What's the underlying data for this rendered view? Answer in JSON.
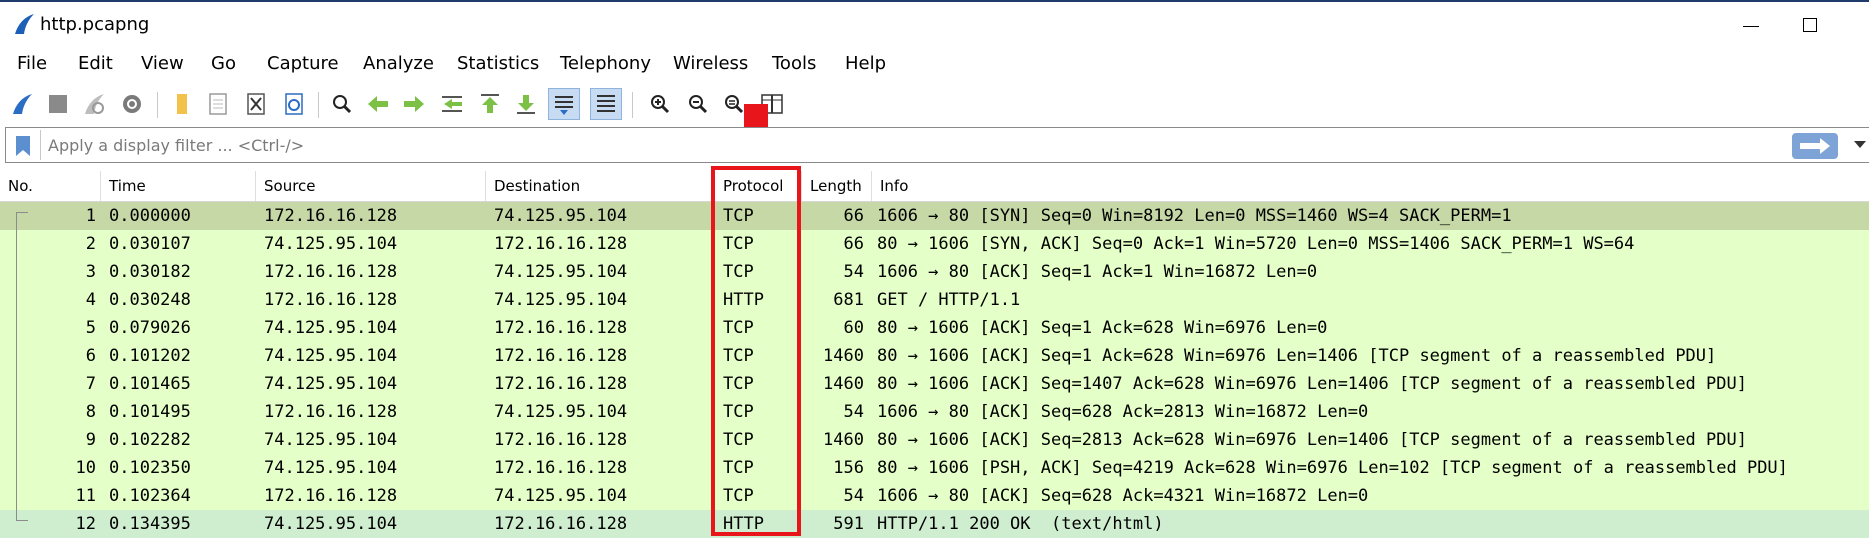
{
  "window": {
    "title": "http.pcapng"
  },
  "menu": [
    {
      "label": "File"
    },
    {
      "label": "Edit"
    },
    {
      "label": "View"
    },
    {
      "label": "Go"
    },
    {
      "label": "Capture"
    },
    {
      "label": "Analyze"
    },
    {
      "label": "Statistics"
    },
    {
      "label": "Telephony"
    },
    {
      "label": "Wireless"
    },
    {
      "label": "Tools"
    },
    {
      "label": "Help"
    }
  ],
  "toolbar": {
    "icons": [
      "start-capture-icon",
      "stop-capture-icon",
      "restart-capture-icon",
      "capture-options-icon",
      "open-file-icon",
      "save-file-icon",
      "close-file-icon",
      "reload-file-icon",
      "find-packet-icon",
      "go-back-icon",
      "go-forward-icon",
      "go-to-packet-icon",
      "first-packet-icon",
      "last-packet-icon",
      "autoscroll-icon",
      "colorize-icon",
      "zoom-in-icon",
      "zoom-out-icon",
      "normal-size-icon",
      "resize-columns-icon"
    ]
  },
  "filter": {
    "placeholder": "Apply a display filter ... <Ctrl-/>"
  },
  "columns": {
    "no": "No.",
    "time": "Time",
    "source": "Source",
    "destination": "Destination",
    "protocol": "Protocol",
    "length": "Length",
    "info": "Info"
  },
  "packets": [
    {
      "no": "1",
      "time": "0.000000",
      "source": "172.16.16.128",
      "destination": "74.125.95.104",
      "protocol": "TCP",
      "length": "66",
      "info": "1606 → 80 [SYN] Seq=0 Win=8192 Len=0 MSS=1460 WS=4 SACK_PERM=1"
    },
    {
      "no": "2",
      "time": "0.030107",
      "source": "74.125.95.104",
      "destination": "172.16.16.128",
      "protocol": "TCP",
      "length": "66",
      "info": "80 → 1606 [SYN, ACK] Seq=0 Ack=1 Win=5720 Len=0 MSS=1406 SACK_PERM=1 WS=64"
    },
    {
      "no": "3",
      "time": "0.030182",
      "source": "172.16.16.128",
      "destination": "74.125.95.104",
      "protocol": "TCP",
      "length": "54",
      "info": "1606 → 80 [ACK] Seq=1 Ack=1 Win=16872 Len=0"
    },
    {
      "no": "4",
      "time": "0.030248",
      "source": "172.16.16.128",
      "destination": "74.125.95.104",
      "protocol": "HTTP",
      "length": "681",
      "info": "GET / HTTP/1.1"
    },
    {
      "no": "5",
      "time": "0.079026",
      "source": "74.125.95.104",
      "destination": "172.16.16.128",
      "protocol": "TCP",
      "length": "60",
      "info": "80 → 1606 [ACK] Seq=1 Ack=628 Win=6976 Len=0"
    },
    {
      "no": "6",
      "time": "0.101202",
      "source": "74.125.95.104",
      "destination": "172.16.16.128",
      "protocol": "TCP",
      "length": "1460",
      "info": "80 → 1606 [ACK] Seq=1 Ack=628 Win=6976 Len=1406 [TCP segment of a reassembled PDU]"
    },
    {
      "no": "7",
      "time": "0.101465",
      "source": "74.125.95.104",
      "destination": "172.16.16.128",
      "protocol": "TCP",
      "length": "1460",
      "info": "80 → 1606 [ACK] Seq=1407 Ack=628 Win=6976 Len=1406 [TCP segment of a reassembled PDU]"
    },
    {
      "no": "8",
      "time": "0.101495",
      "source": "172.16.16.128",
      "destination": "74.125.95.104",
      "protocol": "TCP",
      "length": "54",
      "info": "1606 → 80 [ACK] Seq=628 Ack=2813 Win=16872 Len=0"
    },
    {
      "no": "9",
      "time": "0.102282",
      "source": "74.125.95.104",
      "destination": "172.16.16.128",
      "protocol": "TCP",
      "length": "1460",
      "info": "80 → 1606 [ACK] Seq=2813 Ack=628 Win=6976 Len=1406 [TCP segment of a reassembled PDU]"
    },
    {
      "no": "10",
      "time": "0.102350",
      "source": "74.125.95.104",
      "destination": "172.16.16.128",
      "protocol": "TCP",
      "length": "156",
      "info": "80 → 1606 [PSH, ACK] Seq=4219 Ack=628 Win=6976 Len=102 [TCP segment of a reassembled PDU]"
    },
    {
      "no": "11",
      "time": "0.102364",
      "source": "172.16.16.128",
      "destination": "74.125.95.104",
      "protocol": "TCP",
      "length": "54",
      "info": "1606 → 80 [ACK] Seq=628 Ack=4321 Win=16872 Len=0"
    },
    {
      "no": "12",
      "time": "0.134395",
      "source": "74.125.95.104",
      "destination": "172.16.16.128",
      "protocol": "HTTP",
      "length": "591",
      "info": "HTTP/1.1 200 OK  (text/html)"
    }
  ],
  "colors": {
    "tcp_row": "#e4ffc7",
    "http_last_row": "#cfeed0",
    "selected_row": "#c6d8a6",
    "highlight": "#e8151b",
    "apply_button": "#7ea3d6"
  }
}
